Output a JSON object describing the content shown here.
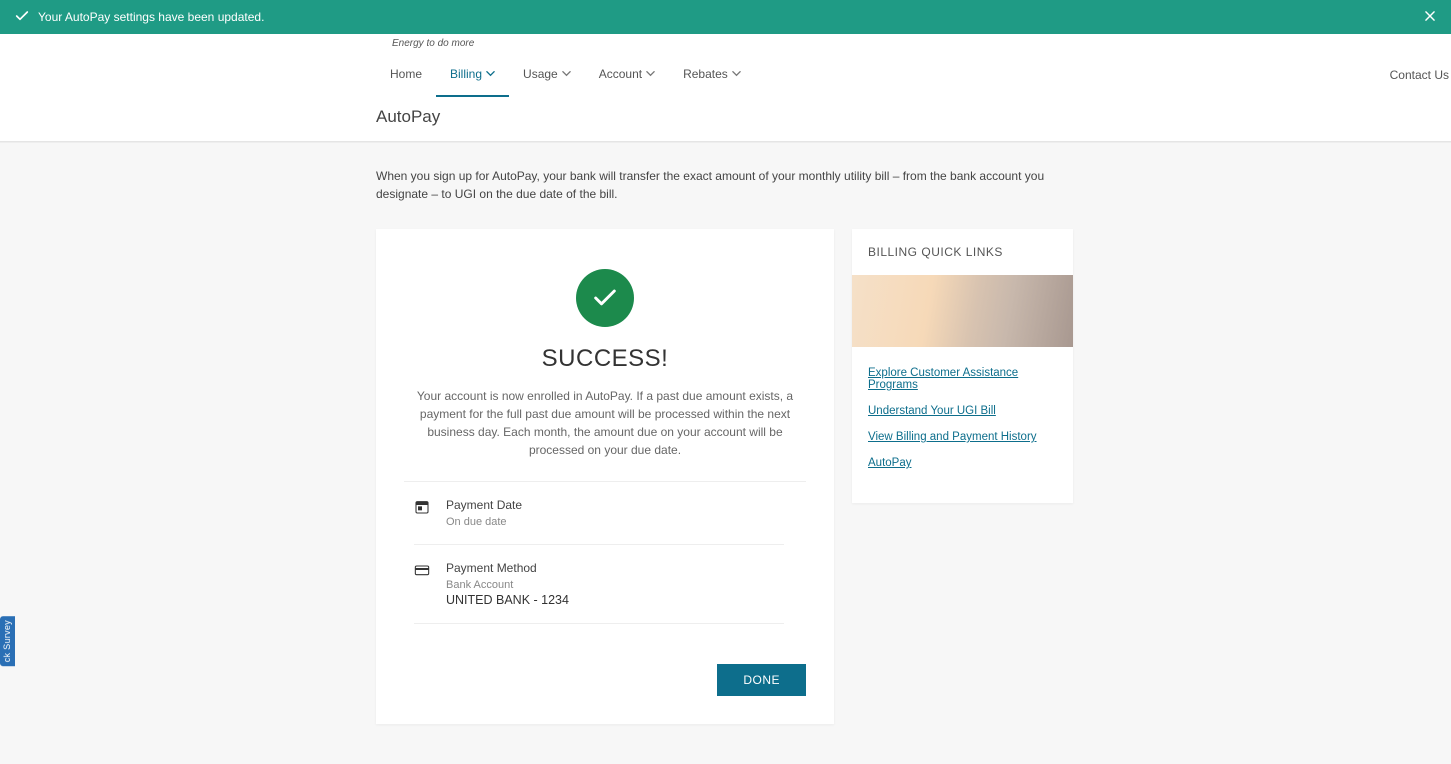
{
  "banner": {
    "message": "Your AutoPay settings have been updated."
  },
  "header": {
    "tagline": "Energy to do more",
    "nav": {
      "home": "Home",
      "billing": "Billing",
      "usage": "Usage",
      "account": "Account",
      "rebates": "Rebates"
    },
    "contact": "Contact Us",
    "page_title": "AutoPay"
  },
  "intro": "When you sign up for AutoPay, your bank will transfer the exact amount of your monthly utility bill – from the bank account you designate – to UGI on the due date of the bill.",
  "success": {
    "title": "SUCCESS!",
    "body": "Your account is now enrolled in AutoPay. If a past due amount exists, a payment for the full past due amount will be processed within the next business day. Each month, the amount due on your account will be processed on your due date."
  },
  "payment_date": {
    "label": "Payment Date",
    "value": "On due date"
  },
  "payment_method": {
    "label": "Payment Method",
    "type": "Bank Account",
    "account": "UNITED BANK - 1234"
  },
  "done_label": "DONE",
  "sidebar": {
    "title": "BILLING QUICK LINKS",
    "links": [
      "Explore Customer Assistance Programs",
      "Understand Your UGI Bill",
      "View Billing and Payment History",
      "AutoPay"
    ]
  },
  "survey_tab": "ck Survey"
}
